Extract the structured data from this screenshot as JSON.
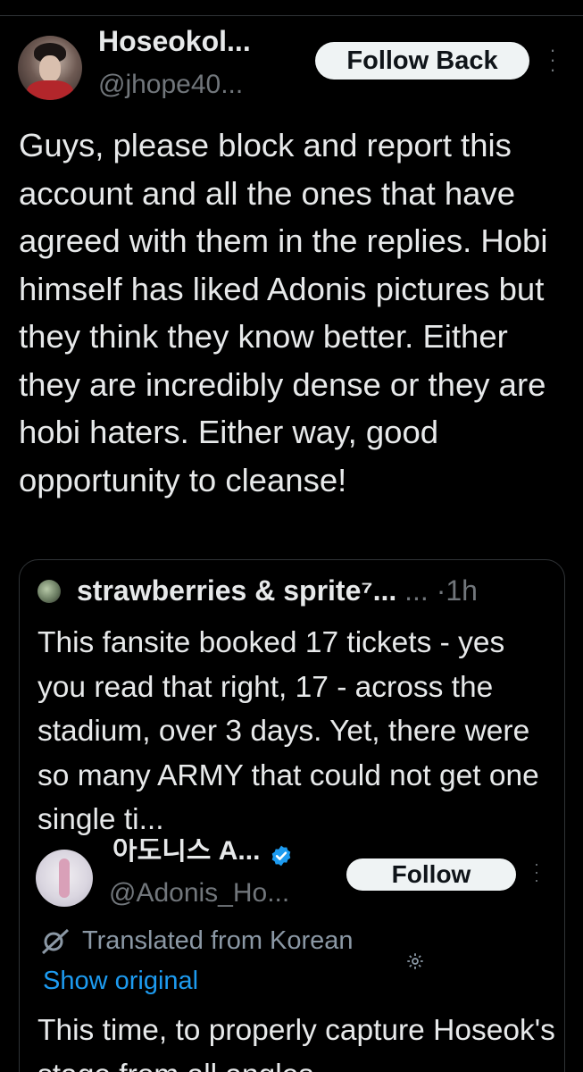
{
  "post": {
    "author": {
      "display_name": "Hoseokol...",
      "handle": "@jhope40..."
    },
    "follow_back_label": "Follow Back",
    "more_icon": "more-vertical-icon",
    "text": "Guys, please block and report this account and all the ones that have agreed with them in the replies. Hobi himself has liked Adonis pictures but they think they know better. Either they are incredibly dense or they are hobi haters. Either way, good opportunity to cleanse!"
  },
  "quote": {
    "author": {
      "display_name": "strawberries & sprite⁷...",
      "ellipsis": "...",
      "separator": "·",
      "time": "1h"
    },
    "text": "This fansite booked 17 tickets - yes you read that right, 17 - across the stadium, over 3 days. Yet, there were so many ARMY that could not get one single ti...",
    "embedded": {
      "display_name": "아도니스 A...",
      "verified_icon": "verified-badge-icon",
      "handle": "@Adonis_Ho...",
      "follow_label": "Follow",
      "translated_label": "Translated from Korean",
      "show_original_label": "Show original",
      "text": "This time, to properly capture Hoseok's stage from all angles"
    }
  },
  "colors": {
    "background": "#000000",
    "text_primary": "#e7e9ea",
    "text_secondary": "#71767b",
    "link": "#1d9bf0",
    "button_bg": "#eff3f4",
    "border": "#2f3336"
  }
}
